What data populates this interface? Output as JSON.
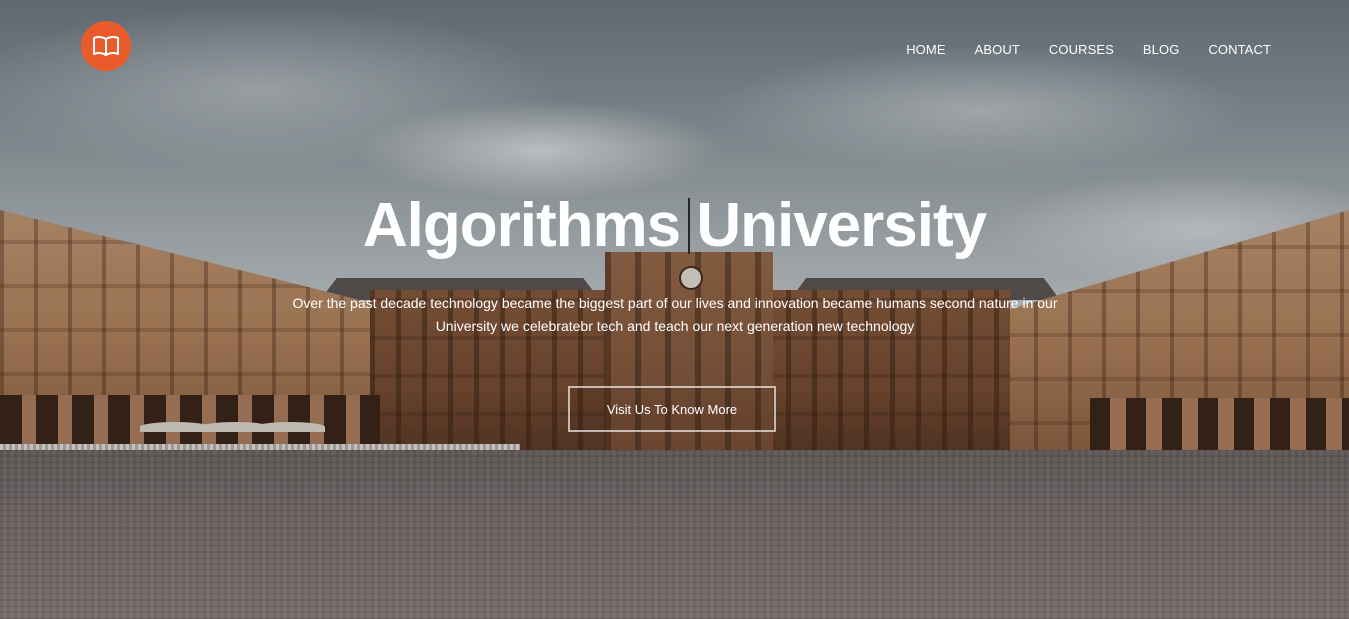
{
  "brand": {
    "logo_icon": "open-book-icon",
    "logo_color": "#ea5b2b"
  },
  "nav": {
    "items": [
      {
        "label": "HOME"
      },
      {
        "label": "ABOUT"
      },
      {
        "label": "COURSES"
      },
      {
        "label": "BLOG"
      },
      {
        "label": "CONTACT"
      }
    ]
  },
  "hero": {
    "title": "Algorithms University",
    "subtitle": "Over the past decade technology became the biggest part of our lives and innovation became humans second nature in our University we celebratebr tech and teach our next generation new technology",
    "cta_label": "Visit Us To Know More"
  }
}
